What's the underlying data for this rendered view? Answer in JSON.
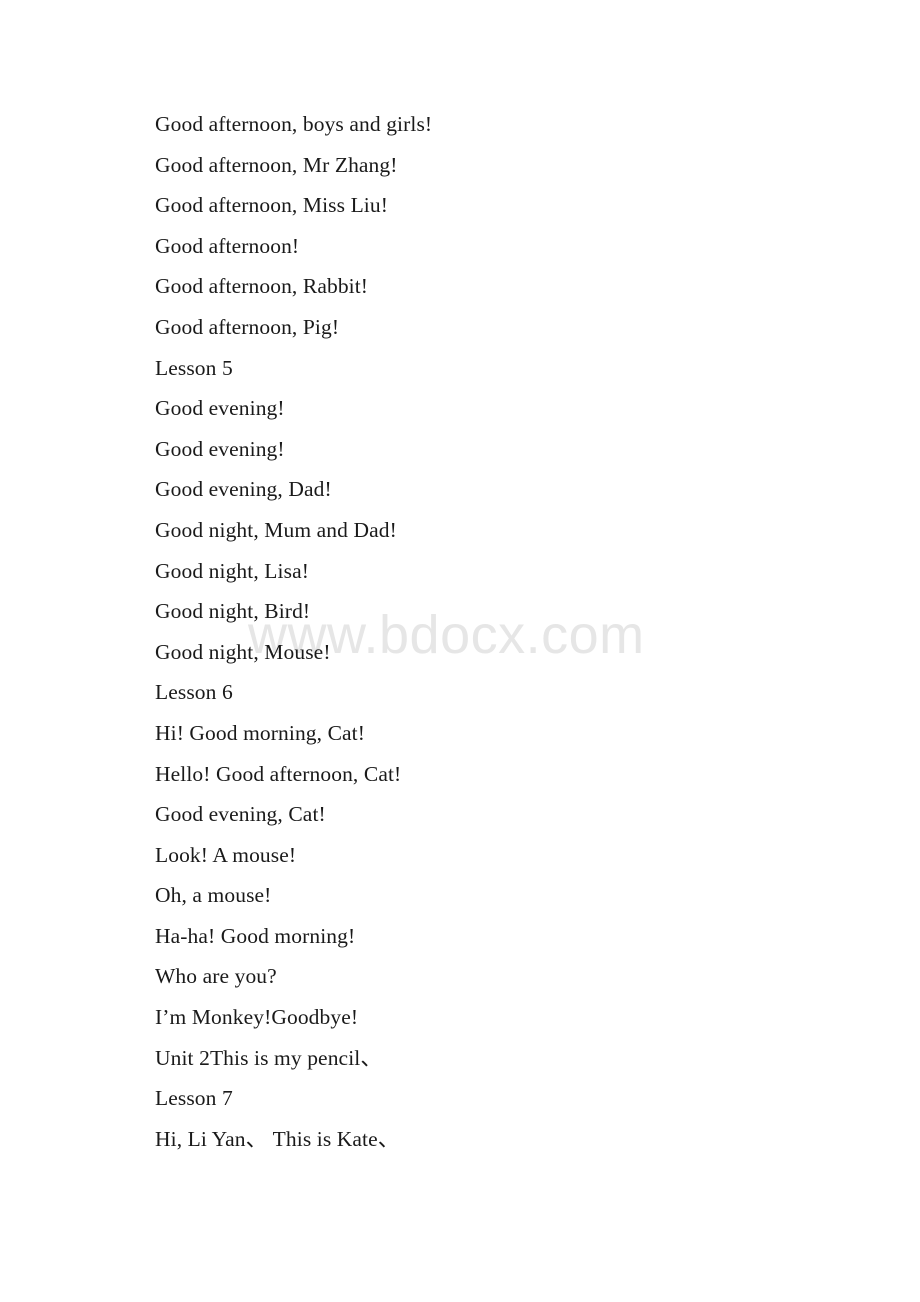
{
  "document": {
    "background_color": "#ffffff",
    "text_color": "#1a1a1a",
    "lines": [
      {
        "id": "line-1",
        "text": "Good afternoon, boys and girls!"
      },
      {
        "id": "line-2",
        "text": "Good afternoon, Mr Zhang!"
      },
      {
        "id": "line-3",
        "text": "Good afternoon, Miss Liu!"
      },
      {
        "id": "line-4",
        "text": "Good afternoon!"
      },
      {
        "id": "line-5",
        "text": "Good afternoon, Rabbit!"
      },
      {
        "id": "line-6",
        "text": "Good afternoon, Pig!"
      },
      {
        "id": "line-7",
        "text": "Lesson 5"
      },
      {
        "id": "line-8",
        "text": "Good evening!"
      },
      {
        "id": "line-9",
        "text": "Good evening!"
      },
      {
        "id": "line-10",
        "text": "Good evening, Dad!"
      },
      {
        "id": "line-11",
        "text": "Good night, Mum and Dad!"
      },
      {
        "id": "line-12",
        "text": "Good night, Lisa!"
      },
      {
        "id": "line-13",
        "text": "Good night, Bird!"
      },
      {
        "id": "line-14",
        "text": "Good night, Mouse!"
      },
      {
        "id": "line-15",
        "text": "Lesson 6"
      },
      {
        "id": "line-16",
        "text": "Hi! Good morning, Cat!"
      },
      {
        "id": "line-17",
        "text": "Hello! Good afternoon, Cat!"
      },
      {
        "id": "line-18",
        "text": "Good evening, Cat!"
      },
      {
        "id": "line-19",
        "text": "Look! A mouse!"
      },
      {
        "id": "line-20",
        "text": "Oh, a mouse!"
      },
      {
        "id": "line-21",
        "text": "Ha-ha! Good morning!"
      },
      {
        "id": "line-22",
        "text": "Who are you?"
      },
      {
        "id": "line-23",
        "text": "I’m Monkey!Goodbye!"
      },
      {
        "id": "line-24",
        "text": "Unit 2This is my pencil、"
      },
      {
        "id": "line-25",
        "text": "Lesson 7"
      },
      {
        "id": "line-26",
        "text": "Hi, Li Yan、 This is Kate、"
      }
    ]
  },
  "watermark": {
    "text": "www.bdocx.com",
    "color": "#e6e6e6"
  }
}
